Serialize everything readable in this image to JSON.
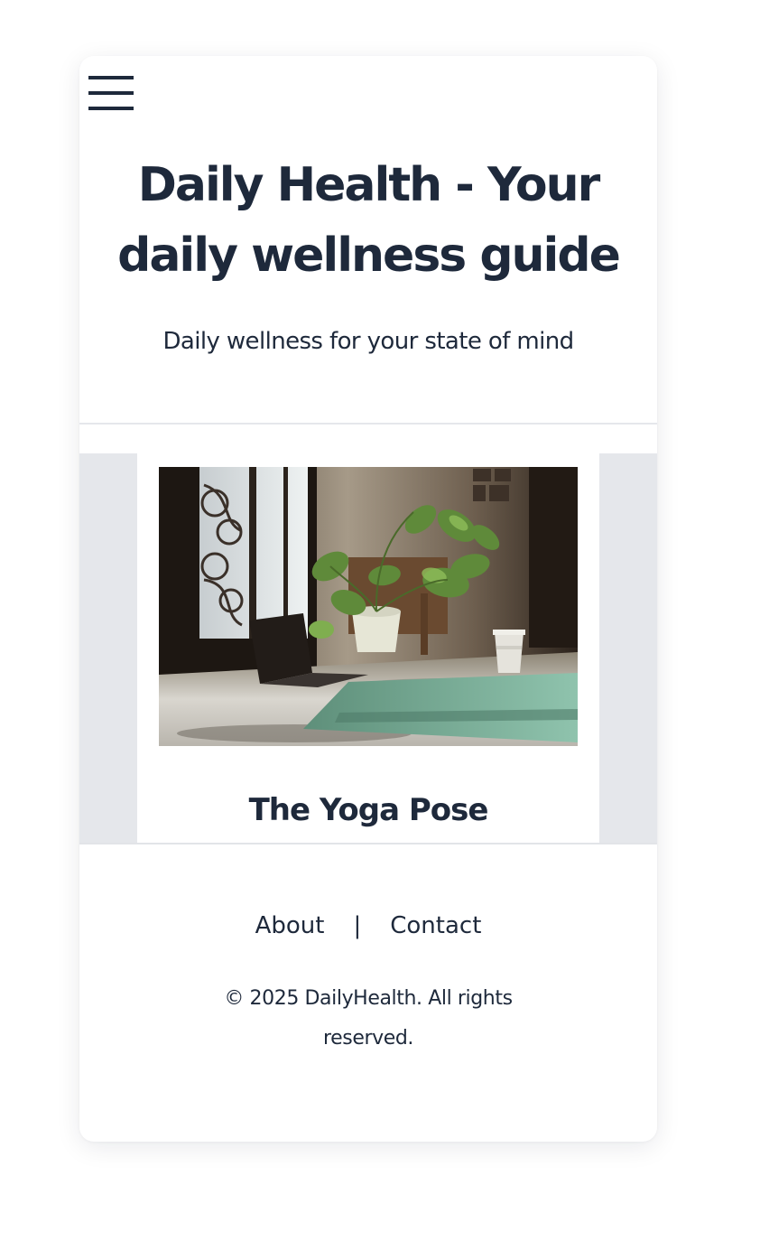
{
  "header": {
    "menu_icon": "hamburger-menu-icon",
    "title": "Daily Health - Your daily wellness guide",
    "tagline": "Daily wellness for your state of mind"
  },
  "featured_post": {
    "image_alt": "Sunlit room with potted monstera plant, laptop and green yoga mat",
    "title": "The Yoga Pose"
  },
  "footer": {
    "links": [
      "About",
      "Contact"
    ],
    "separator": "|",
    "copyright": "© 2025 DailyHealth. All rights reserved."
  },
  "colors": {
    "text": "#1e293b",
    "band": "#e5e7eb",
    "card": "#ffffff"
  }
}
